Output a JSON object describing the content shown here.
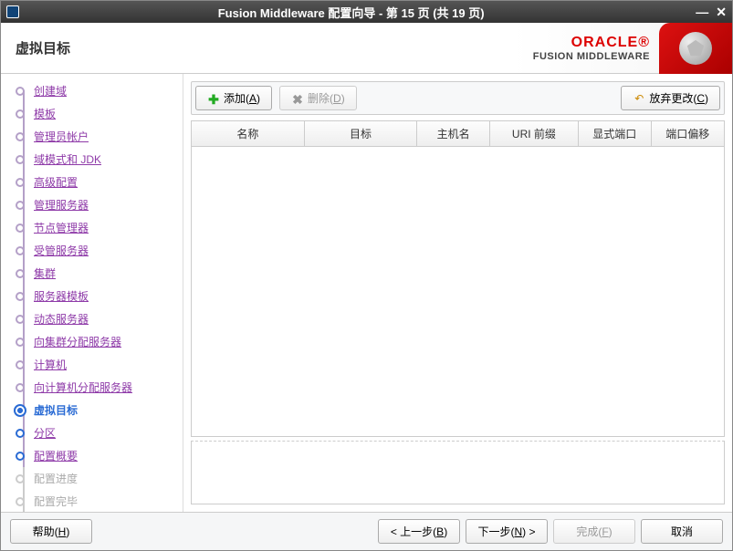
{
  "window": {
    "title": "Fusion Middleware 配置向导 - 第 15 页 (共 19 页)"
  },
  "header": {
    "page_title": "虚拟目标",
    "brand_name": "ORACLE",
    "brand_sub": "FUSION MIDDLEWARE"
  },
  "sidebar": {
    "steps": [
      {
        "label": "创建域",
        "state": "done"
      },
      {
        "label": "模板",
        "state": "done"
      },
      {
        "label": "管理员帐户",
        "state": "done"
      },
      {
        "label": "域模式和 JDK",
        "state": "done"
      },
      {
        "label": "高级配置",
        "state": "done"
      },
      {
        "label": "管理服务器",
        "state": "done"
      },
      {
        "label": "节点管理器",
        "state": "done"
      },
      {
        "label": "受管服务器",
        "state": "done"
      },
      {
        "label": "集群",
        "state": "done"
      },
      {
        "label": "服务器模板",
        "state": "done"
      },
      {
        "label": "动态服务器",
        "state": "done"
      },
      {
        "label": "向集群分配服务器",
        "state": "done"
      },
      {
        "label": "计算机",
        "state": "done"
      },
      {
        "label": "向计算机分配服务器",
        "state": "done"
      },
      {
        "label": "虚拟目标",
        "state": "active"
      },
      {
        "label": "分区",
        "state": "future"
      },
      {
        "label": "配置概要",
        "state": "future"
      },
      {
        "label": "配置进度",
        "state": "disabled"
      },
      {
        "label": "配置完毕",
        "state": "disabled"
      }
    ]
  },
  "toolbar": {
    "add_label": "添加",
    "add_mn": "A",
    "del_label": "删除",
    "del_mn": "D",
    "discard_label": "放弃更改",
    "discard_mn": "C"
  },
  "table": {
    "headers": [
      "名称",
      "目标",
      "主机名",
      "URI 前缀",
      "显式端口",
      "端口偏移"
    ]
  },
  "footer": {
    "help_label": "帮助",
    "help_mn": "H",
    "back_label": "上一步",
    "back_mn": "B",
    "next_label": "下一步",
    "next_mn": "N",
    "finish_label": "完成",
    "finish_mn": "F",
    "cancel_label": "取消"
  }
}
